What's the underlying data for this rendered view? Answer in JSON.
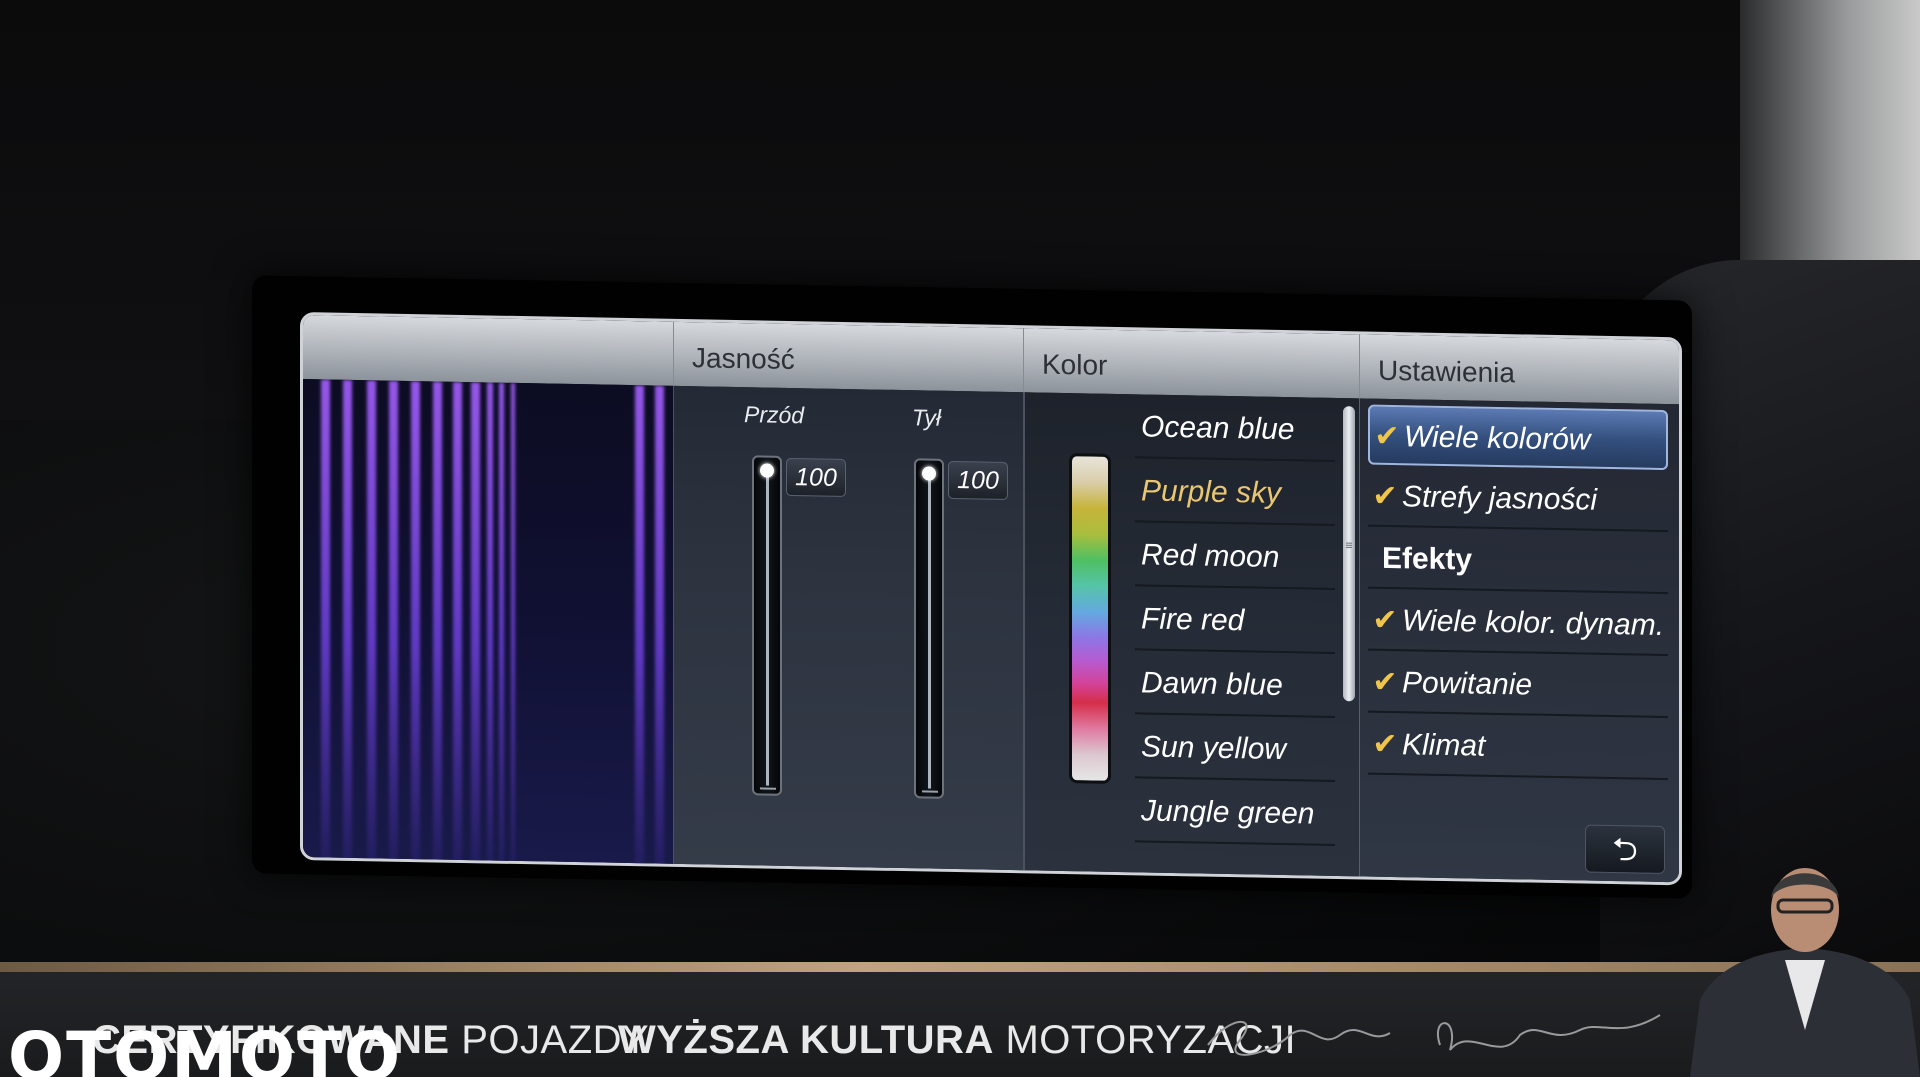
{
  "header": {
    "brightness_title": "Jasność",
    "color_title": "Kolor",
    "settings_title": "Ustawienia"
  },
  "brightness": {
    "front": {
      "label": "Przód",
      "value": "100",
      "level": 1.0
    },
    "rear": {
      "label": "Tył",
      "value": "100",
      "level": 1.0
    }
  },
  "colors": {
    "selected": "Purple sky",
    "items": [
      {
        "label": "Ocean blue"
      },
      {
        "label": "Purple sky"
      },
      {
        "label": "Red moon"
      },
      {
        "label": "Fire red"
      },
      {
        "label": "Dawn blue"
      },
      {
        "label": "Sun yellow"
      },
      {
        "label": "Jungle green"
      }
    ],
    "accent_selected": "#e9c772"
  },
  "settings": {
    "items": [
      {
        "label": "Wiele kolorów",
        "checked": true,
        "active": true
      },
      {
        "label": "Strefy jasności",
        "checked": true
      },
      {
        "label": "Efekty",
        "heading": true
      },
      {
        "label": "Wiele kolor. dynam.",
        "checked": true
      },
      {
        "label": "Powitanie",
        "checked": true
      },
      {
        "label": "Klimat",
        "checked": true
      }
    ],
    "back_icon": "back-arrow-icon"
  },
  "banner": {
    "logo": "OTOMOTO",
    "certified_bold": "CERTYFIKOWANE",
    "certified_rest": "POJAZDY",
    "culture_bold": "WYŻSZA KULTURA",
    "culture_rest": "MOTORYZACJI",
    "accent": "#c1a37e"
  }
}
